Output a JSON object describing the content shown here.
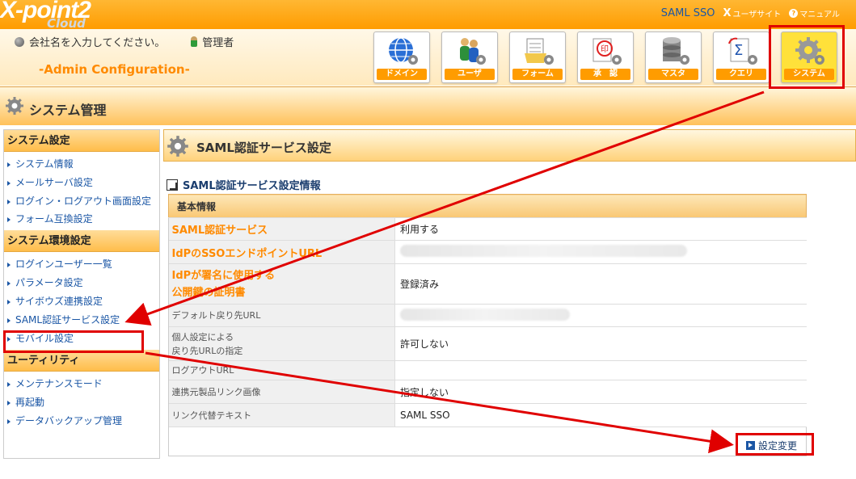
{
  "header": {
    "logo": "X-point2",
    "logo_sub": "Cloud",
    "saml_sso": "SAML SSO",
    "user_site": "ユーザサイト",
    "manual": "マニュアル",
    "company": "会社名を入力してください。",
    "role": "管理者",
    "admin_config": "-Admin Configuration-",
    "menu": [
      {
        "label": "ドメイン",
        "icon": "globe-icon"
      },
      {
        "label": "ユーザ",
        "icon": "users-icon"
      },
      {
        "label": "フォーム",
        "icon": "form-icon"
      },
      {
        "label": "承　認",
        "icon": "approval-stamp-icon"
      },
      {
        "label": "マスタ",
        "icon": "database-icon"
      },
      {
        "label": "クエリ",
        "icon": "query-sigma-icon"
      },
      {
        "label": "システム",
        "icon": "system-gear-icon"
      }
    ]
  },
  "page_title": "システム管理",
  "sidebar": {
    "sections": [
      {
        "title": "システム設定",
        "items": [
          "システム情報",
          "メールサーバ設定",
          "ログイン・ログアウト画面設定",
          "フォーム互換設定"
        ]
      },
      {
        "title": "システム環境設定",
        "items": [
          "ログインユーザー一覧",
          "パラメータ設定",
          "サイボウズ連携設定",
          "SAML認証サービス設定",
          "モバイル設定"
        ]
      },
      {
        "title": "ユーティリティ",
        "items": [
          "メンテナンスモード",
          "再起動",
          "データバックアップ管理"
        ]
      }
    ]
  },
  "main": {
    "title": "SAML認証サービス設定",
    "section_title": "SAML認証サービス設定情報",
    "group_label": "基本情報",
    "rows": [
      {
        "label": "SAML認証サービス",
        "value": "利用する"
      },
      {
        "label": "IdPのSSOエンドポイントURL",
        "value": ""
      },
      {
        "label": "IdPが署名に使用する\n公開鍵の証明書",
        "value": "登録済み"
      },
      {
        "label": "デフォルト戻り先URL",
        "value": ""
      },
      {
        "label": "個人設定による\n戻り先URLの指定",
        "value": "許可しない"
      },
      {
        "label": "ログアウトURL",
        "value": ""
      },
      {
        "label": "連携元製品リンク画像",
        "value": "指定しない"
      },
      {
        "label": "リンク代替テキスト",
        "value": "SAML SSO"
      }
    ],
    "change_button": "設定変更"
  },
  "colors": {
    "accent": "#ff9c00",
    "link": "#1a56a5",
    "highlight": "#e00000"
  }
}
